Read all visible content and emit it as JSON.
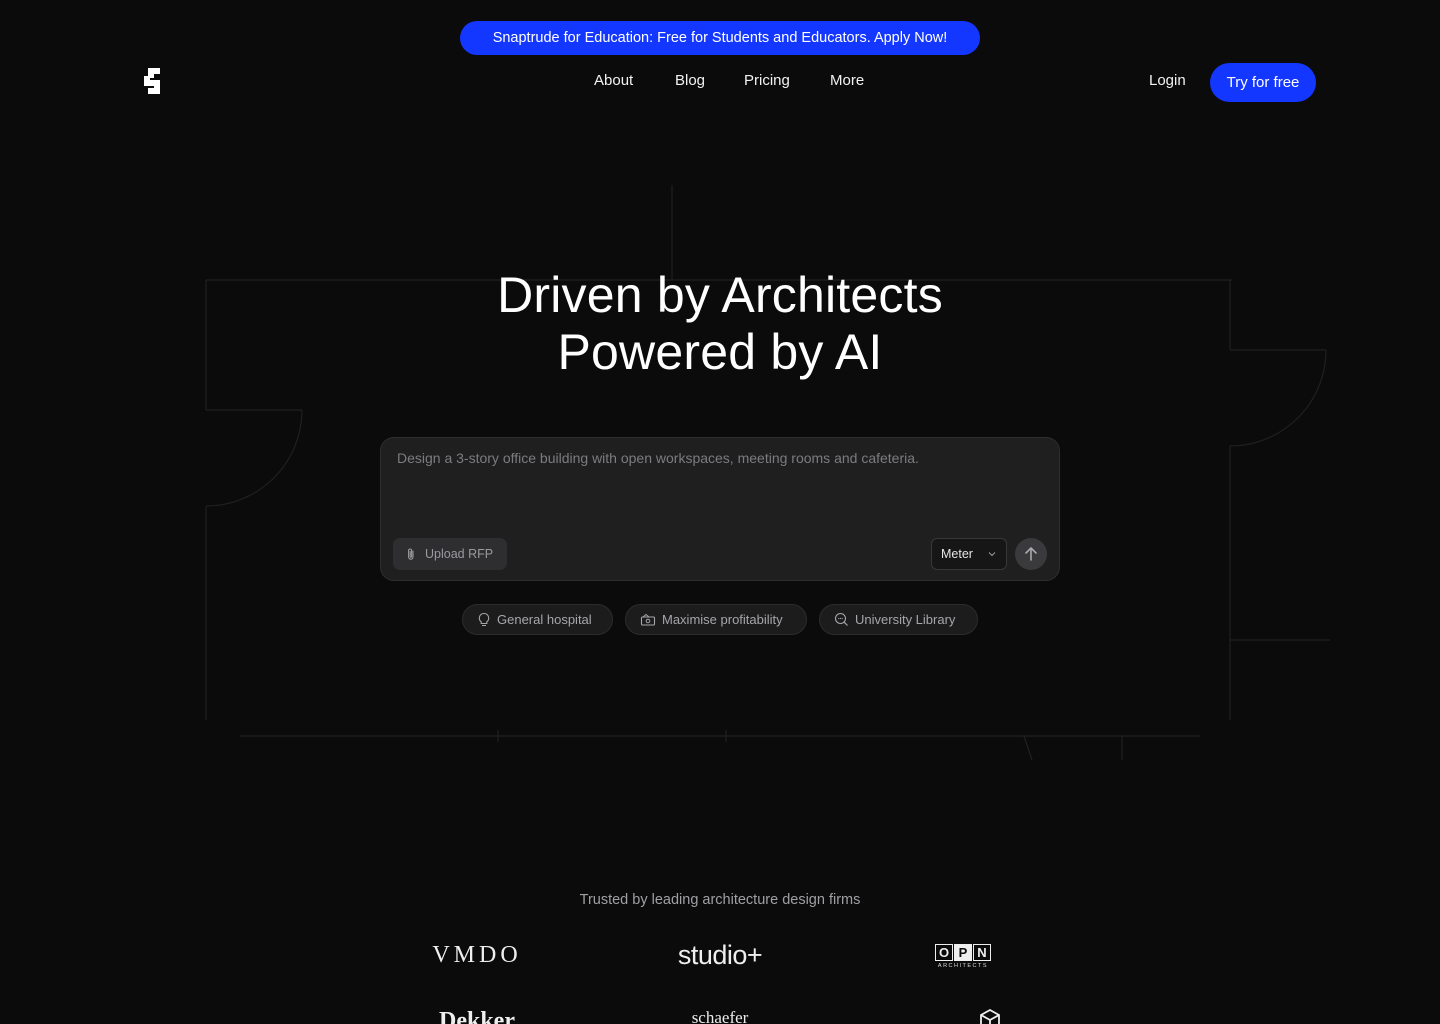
{
  "promo": {
    "text": "Snaptrude for Education: Free for Students and Educators. Apply Now!"
  },
  "header": {
    "nav": [
      "About",
      "Blog",
      "Pricing",
      "More"
    ],
    "login": "Login",
    "cta": "Try for free"
  },
  "hero": {
    "line1": "Driven by Architects",
    "line2": "Powered by AI"
  },
  "prompt": {
    "placeholder": "Design a 3-story office building with open workspaces, meeting rooms and cafeteria.",
    "upload_label": "Upload RFP",
    "unit": "Meter"
  },
  "suggestions": [
    {
      "icon": "lightbulb-icon",
      "label": "General hospital"
    },
    {
      "icon": "money-icon",
      "label": "Maximise profitability"
    },
    {
      "icon": "search-icon",
      "label": "University Library"
    }
  ],
  "trusted": {
    "text": "Trusted by leading architecture design firms",
    "logos": [
      "VMDO",
      "studio+",
      "OPN",
      "ARCHITECTS",
      "Dekker",
      "schaefer"
    ]
  },
  "colors": {
    "accent": "#1437ff",
    "background": "#0b0b0c",
    "input_bg": "#1f1f20"
  }
}
